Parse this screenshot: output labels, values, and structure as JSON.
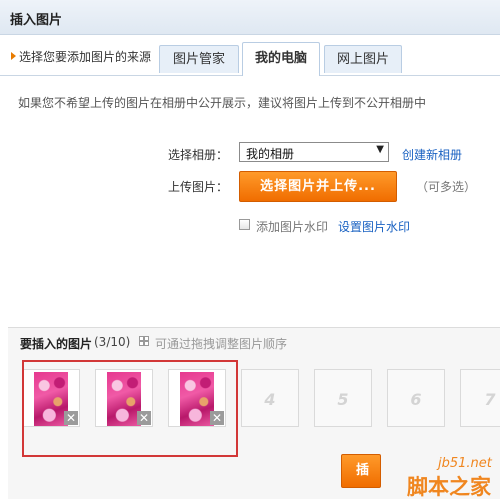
{
  "dialog": {
    "title": "插入图片"
  },
  "source": {
    "label": "选择您要添加图片的来源",
    "tabs": [
      "图片管家",
      "我的电脑",
      "网上图片"
    ]
  },
  "notice": "如果您不希望上传的图片在相册中公开展示，建议将图片上传到不公开相册中",
  "form": {
    "album_label": "选择相册：",
    "album_value": "我的相册",
    "create_album": "创建新相册",
    "upload_label": "上传图片：",
    "upload_button": "选择图片并上传...",
    "multi_hint": "（可多选）",
    "watermark_label": "添加图片水印",
    "watermark_link": "设置图片水印"
  },
  "insert": {
    "title": "要插入的图片",
    "count": "(3/10)",
    "drag_hint": "可通过拖拽调整图片顺序",
    "thumbnails": 3,
    "empty_slots": [
      "4",
      "5",
      "6",
      "7"
    ],
    "remove_symbol": "✕"
  },
  "footer": {
    "confirm_partial": "插"
  },
  "watermark": {
    "site": "jb51.net",
    "name": "脚本之家"
  }
}
